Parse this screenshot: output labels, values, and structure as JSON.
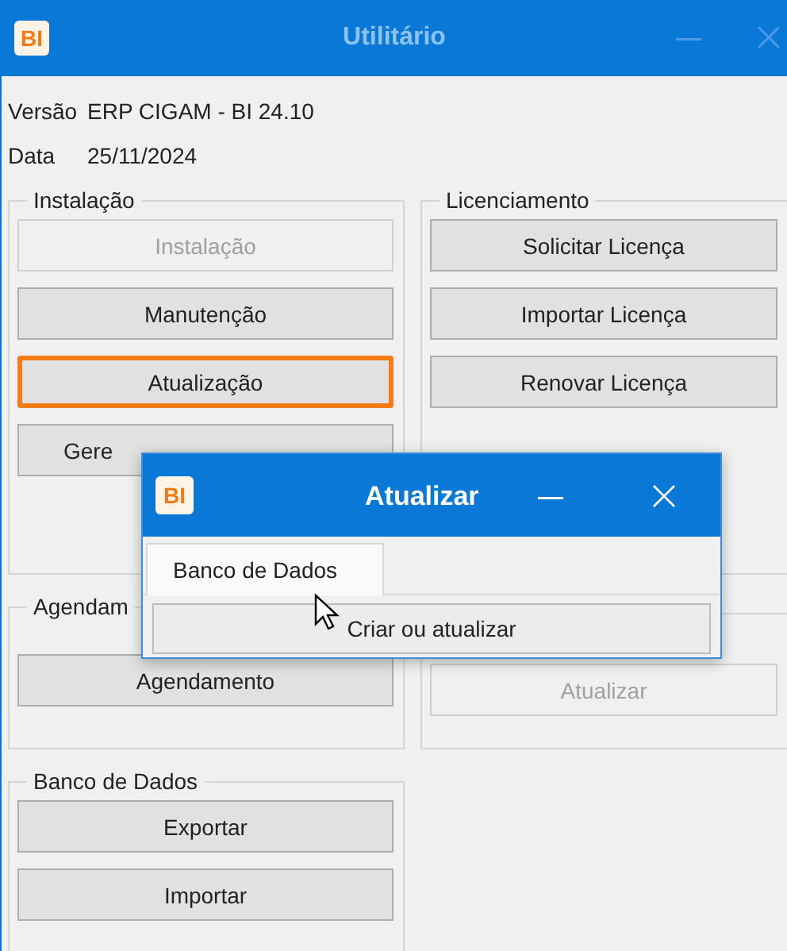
{
  "window": {
    "logo": "BI",
    "title": "Utilitário",
    "active": false
  },
  "info": [
    {
      "label": "Versão",
      "value": "ERP CIGAM - BI 24.10"
    },
    {
      "label": "Data",
      "value": "25/11/2024"
    }
  ],
  "rows": [
    {
      "left": {
        "title": "Instalação",
        "buttons": [
          {
            "label": "Instalação",
            "disabled": true,
            "focused": false
          },
          {
            "label": "Manutenção",
            "disabled": false,
            "focused": false
          },
          {
            "label": "Atualização",
            "disabled": false,
            "focused": true
          },
          {
            "label": "Gere",
            "disabled": false,
            "focused": false,
            "kind": "covered"
          }
        ]
      },
      "right": {
        "title": "Licenciamento",
        "buttons": [
          {
            "label": "Solicitar Licença",
            "disabled": false,
            "focused": false
          },
          {
            "label": "Importar Licença",
            "disabled": false,
            "focused": false
          },
          {
            "label": "Renovar Licença",
            "disabled": false,
            "focused": false
          }
        ]
      }
    },
    {
      "left": {
        "title": "Agendam",
        "buttons": [
          {
            "label": "Agendamento",
            "disabled": false,
            "focused": false
          }
        ]
      },
      "right": {
        "buttons": [
          {
            "label": "Atualizar",
            "disabled": true,
            "focused": false
          }
        ]
      }
    },
    {
      "left": {
        "title": "Banco de Dados",
        "buttons": [
          {
            "label": "Exportar",
            "disabled": false,
            "focused": false
          },
          {
            "label": "Importar",
            "disabled": false,
            "focused": false
          }
        ]
      }
    }
  ],
  "dialog": {
    "logo": "BI",
    "title": "Atualizar",
    "active": true,
    "tabs": [
      {
        "label": "Banco de Dados",
        "selected": true
      }
    ],
    "button": "Criar ou atualizar"
  }
}
